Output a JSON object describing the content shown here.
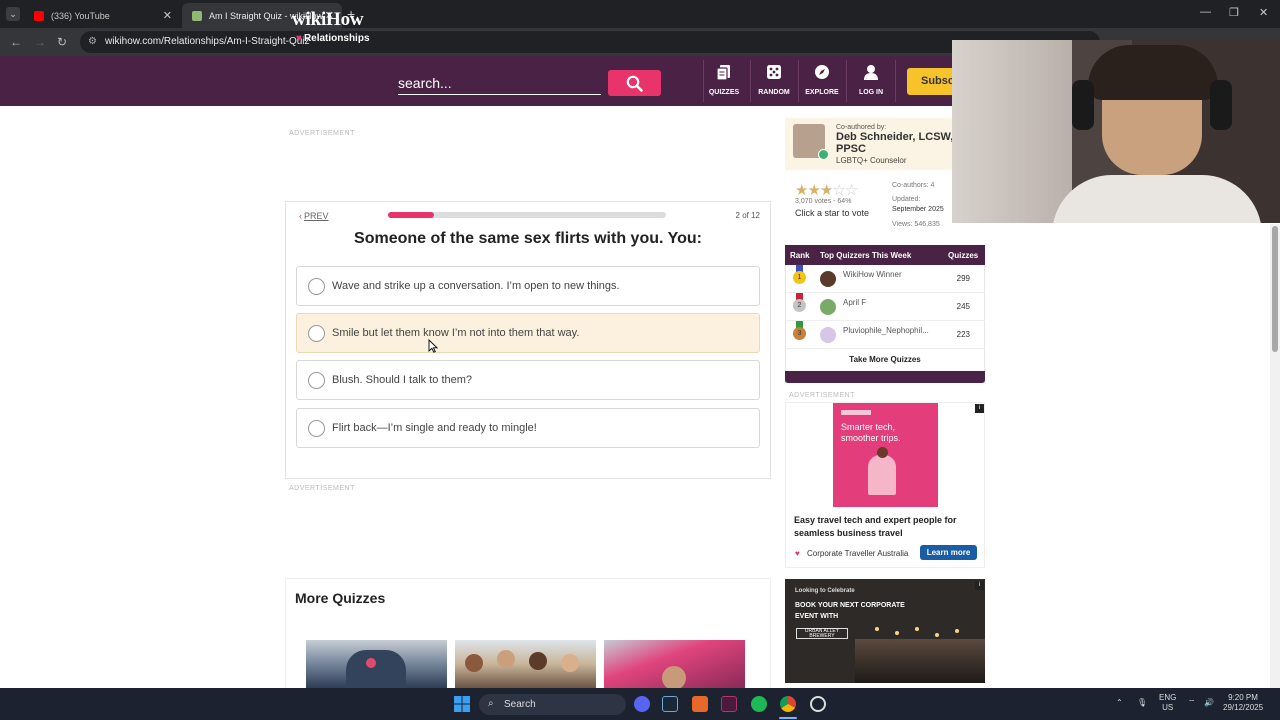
{
  "browser": {
    "tabs": [
      {
        "title": "(336) YouTube",
        "active": false,
        "favicon_color": "#ff0000"
      },
      {
        "title": "Am I Straight Quiz - wikiHow",
        "active": true,
        "favicon_color": "#93b874"
      }
    ],
    "url": "wikihow.com/Relationships/Am-I-Straight-Quiz"
  },
  "header": {
    "brand": "wikiHow",
    "category": "Relationships",
    "search_placeholder": "search...",
    "nav": [
      {
        "label": "QUIZZES",
        "icon": "quizzes-icon"
      },
      {
        "label": "RANDOM",
        "icon": "dice-icon"
      },
      {
        "label": "EXPLORE",
        "icon": "compass-icon"
      },
      {
        "label": "LOG IN",
        "icon": "user-icon"
      }
    ],
    "subscribe_label": "Subscribe",
    "colors": {
      "bar": "#4a2245",
      "accent": "#e8336b",
      "subscribe": "#f6c42a"
    }
  },
  "ads": {
    "label": "ADVERTISEMENT"
  },
  "quiz": {
    "prev_label": "PREV",
    "progress_fraction": 0.167,
    "counter": "2 of 12",
    "question": "Someone of the same sex flirts with you. You:",
    "answers": [
      "Wave and strike up a conversation. I’m open to new things.",
      "Smile but let them know I’m not into them that way.",
      "Blush. Should I talk to them?",
      "Flirt back—I’m single and ready to mingle!"
    ],
    "hovered_answer_index": 1
  },
  "more_quizzes": {
    "title": "More Quizzes"
  },
  "sidebar": {
    "coauthor_label": "Co-authored by:",
    "author_name": "Deb Schneider, LCSW, PPSC",
    "author_role": "LGBTQ+ Counselor",
    "rating_stars": 3,
    "rating_max": 5,
    "votes_text": "3,070 votes - 64%",
    "click_star": "Click a star to vote",
    "coauthors": "Co-authors: 4",
    "updated_label": "Updated:",
    "updated_value": "September 2025",
    "views": "Views: 546,835",
    "leaderboard": {
      "headers": [
        "Rank",
        "Top Quizzers This Week",
        "Quizzes"
      ],
      "rows": [
        {
          "rank": "1",
          "name": "WikiHow Winner",
          "score": "299"
        },
        {
          "rank": "2",
          "name": "April F",
          "score": "245"
        },
        {
          "rank": "3",
          "name": "Pluviophile_Nephophil...",
          "score": "223"
        }
      ],
      "take_more": "Take More Quizzes"
    },
    "ad1": {
      "image_text": "Smarter tech, smoother trips.",
      "headline": "Easy travel tech and expert people for seamless business travel",
      "advertiser": "Corporate Traveller Australia",
      "cta": "Learn more"
    },
    "ad2": {
      "line1": "Looking to Celebrate",
      "line2": "BOOK YOUR NEXT CORPORATE EVENT WITH",
      "logo": "URBAN ALLEY BREWERY"
    }
  },
  "taskbar": {
    "search_label": "Search",
    "lang1": "ENG",
    "lang2": "US",
    "time": "9:20 PM",
    "date": "29/12/2025"
  }
}
